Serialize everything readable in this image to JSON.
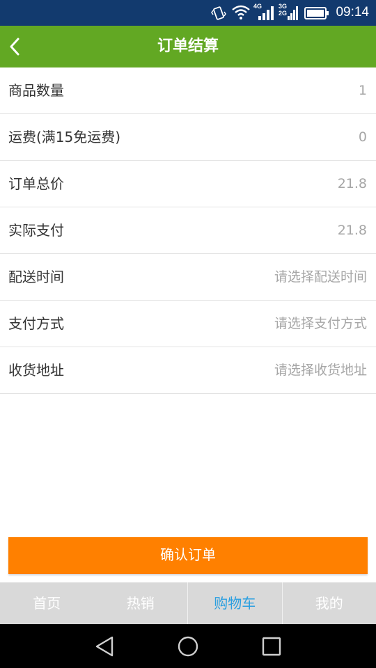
{
  "status": {
    "time": "09:14",
    "net_4g": "4G",
    "net_3g": "3G",
    "net_2g": "2G"
  },
  "header": {
    "title": "订单结算"
  },
  "rows": [
    {
      "label": "商品数量",
      "value": "1"
    },
    {
      "label": "运费(满15免运费)",
      "value": "0"
    },
    {
      "label": "订单总价",
      "value": "21.8"
    },
    {
      "label": "实际支付",
      "value": "21.8"
    },
    {
      "label": "配送时间",
      "value": "请选择配送时间"
    },
    {
      "label": "支付方式",
      "value": "请选择支付方式"
    },
    {
      "label": "收货地址",
      "value": "请选择收货地址"
    }
  ],
  "confirm_label": "确认订单",
  "tabs": [
    {
      "label": "首页"
    },
    {
      "label": "热销"
    },
    {
      "label": "购物车"
    },
    {
      "label": "我的"
    }
  ],
  "colors": {
    "header": "#62a823",
    "accent": "#ff8000",
    "active_tab": "#2a9fe0",
    "status_bar": "#123a6e"
  }
}
